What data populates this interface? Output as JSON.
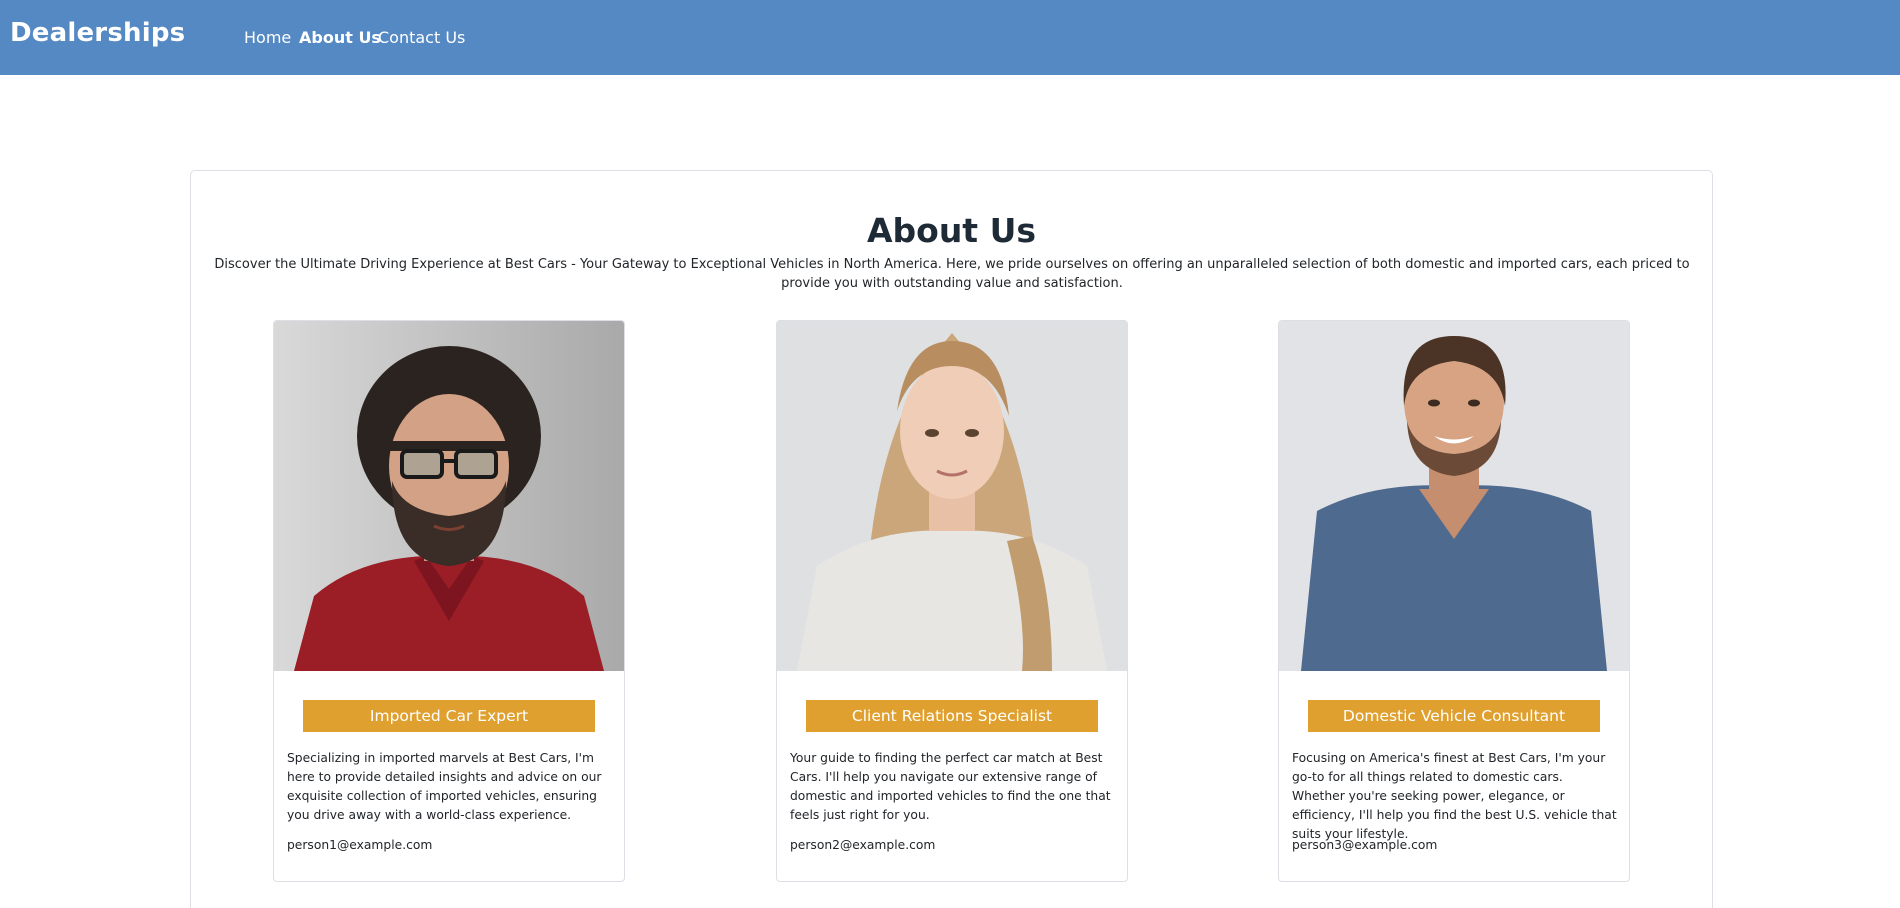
{
  "nav": {
    "brand": "Dealerships",
    "links": [
      {
        "label": "Home",
        "active": false
      },
      {
        "label": "About Us",
        "active": true
      },
      {
        "label": "Contact Us",
        "active": false
      }
    ]
  },
  "page": {
    "title": "About Us",
    "intro": "Discover the Ultimate Driving Experience at Best Cars - Your Gateway to Exceptional Vehicles in North America. Here, we pride ourselves on offering an unparalleled selection of both domestic and imported cars, each priced to provide you with outstanding value and satisfaction."
  },
  "team": [
    {
      "role": "Imported Car Expert",
      "description": "Specializing in imported marvels at Best Cars, I'm here to provide detailed insights and advice on our exquisite collection of imported vehicles, ensuring you drive away with a world-class experience.",
      "email": "person1@example.com"
    },
    {
      "role": "Client Relations Specialist",
      "description": "Your guide to finding the perfect car match at Best Cars. I'll help you navigate our extensive range of domestic and imported vehicles to find the one that feels just right for you.",
      "email": "person2@example.com"
    },
    {
      "role": "Domestic Vehicle Consultant",
      "description": "Focusing on America's finest at Best Cars, I'm your go-to for all things related to domestic cars. Whether you're seeking power, elegance, or efficiency, I'll help you find the best U.S. vehicle that suits your lifestyle.",
      "email": "person3@example.com"
    }
  ],
  "colors": {
    "navbar": "#5589c4",
    "badge": "#e0a030",
    "border": "#dcdfe3"
  }
}
